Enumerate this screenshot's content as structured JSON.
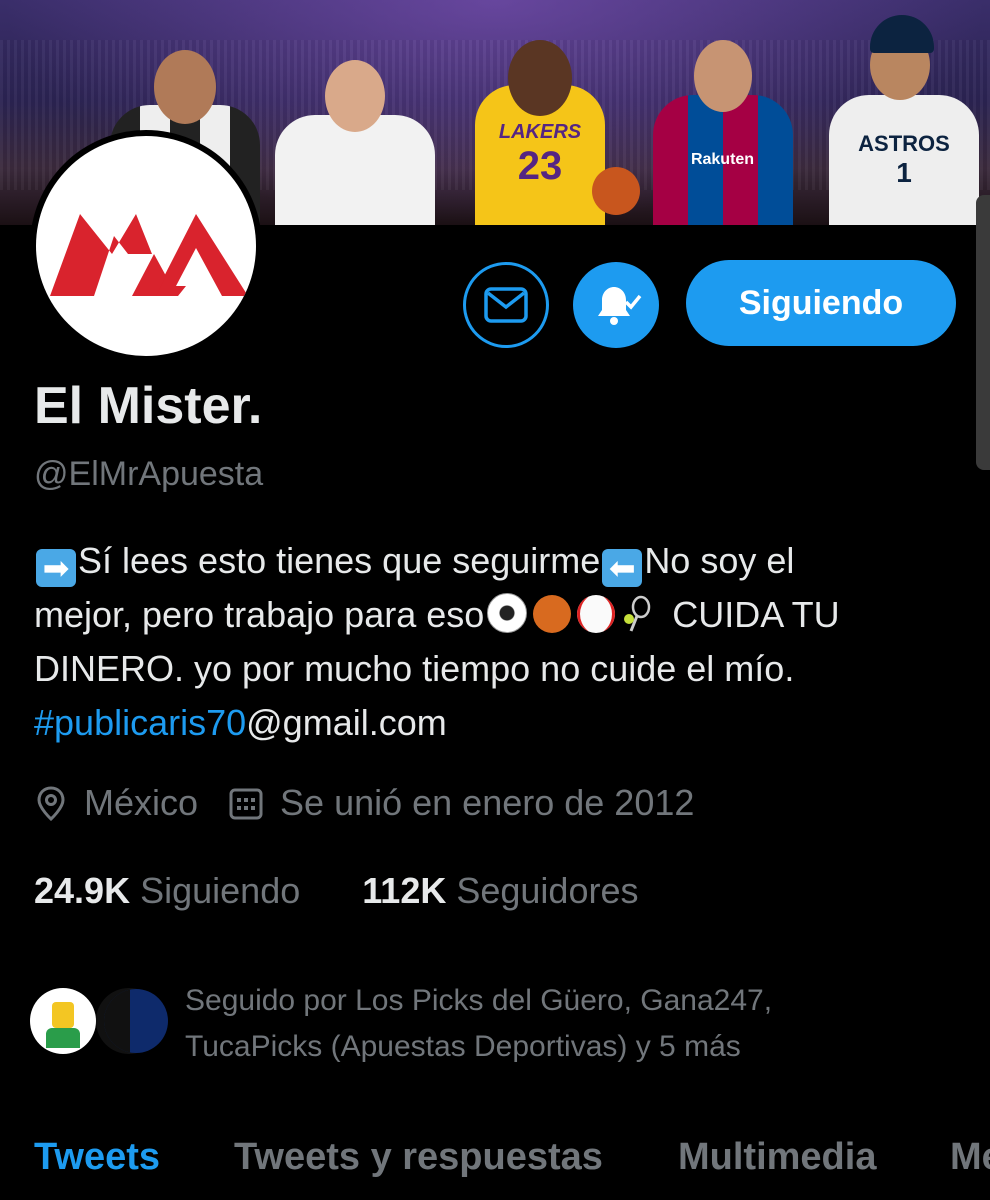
{
  "profile": {
    "name": "El Mister.",
    "handle": "@ElMrApuesta",
    "avatar_text": "MA",
    "bio_lines": [
      {
        "before": "",
        "text1": "Sí lees esto tienes que seguirme",
        "text2": "No soy el"
      },
      {
        "text": "mejor, pero trabajo para eso",
        "after": " CUIDA TU"
      },
      {
        "text": "DINERO. yo por mucho tiempo no cuide el mío."
      },
      {
        "link": "#publicaris70",
        "rest": "@gmail.com"
      }
    ],
    "location": "México",
    "joined": "Se unió en enero de 2012",
    "following_count": "24.9K",
    "following_label": "Siguiendo",
    "followers_count": "112K",
    "followers_label": "Seguidores",
    "followed_by_line1": "Seguido por Los Picks del Güero, Gana247,",
    "followed_by_line2": "TucaPicks (Apuestas Deportivas) y 5 más"
  },
  "banner": {
    "jersey_numbers": [
      "23",
      "1"
    ],
    "jersey_text": [
      "LAKERS",
      "Rakuten",
      "ASTROS"
    ]
  },
  "actions": {
    "follow_label": "Siguiendo"
  },
  "tabs": [
    {
      "label": "Tweets"
    },
    {
      "label": "Tweets y respuestas"
    },
    {
      "label": "Multimedia"
    },
    {
      "label": "Me"
    }
  ],
  "colors": {
    "accent": "#1d9bf0",
    "muted": "#71767b",
    "background": "#000000",
    "logo_red": "#d9232d"
  },
  "icons": [
    "mail-icon",
    "bell-check-icon",
    "location-pin-icon",
    "calendar-icon",
    "soccer-ball-icon",
    "basketball-icon",
    "baseball-icon",
    "tennis-icon",
    "right-arrow-icon",
    "left-arrow-icon"
  ]
}
